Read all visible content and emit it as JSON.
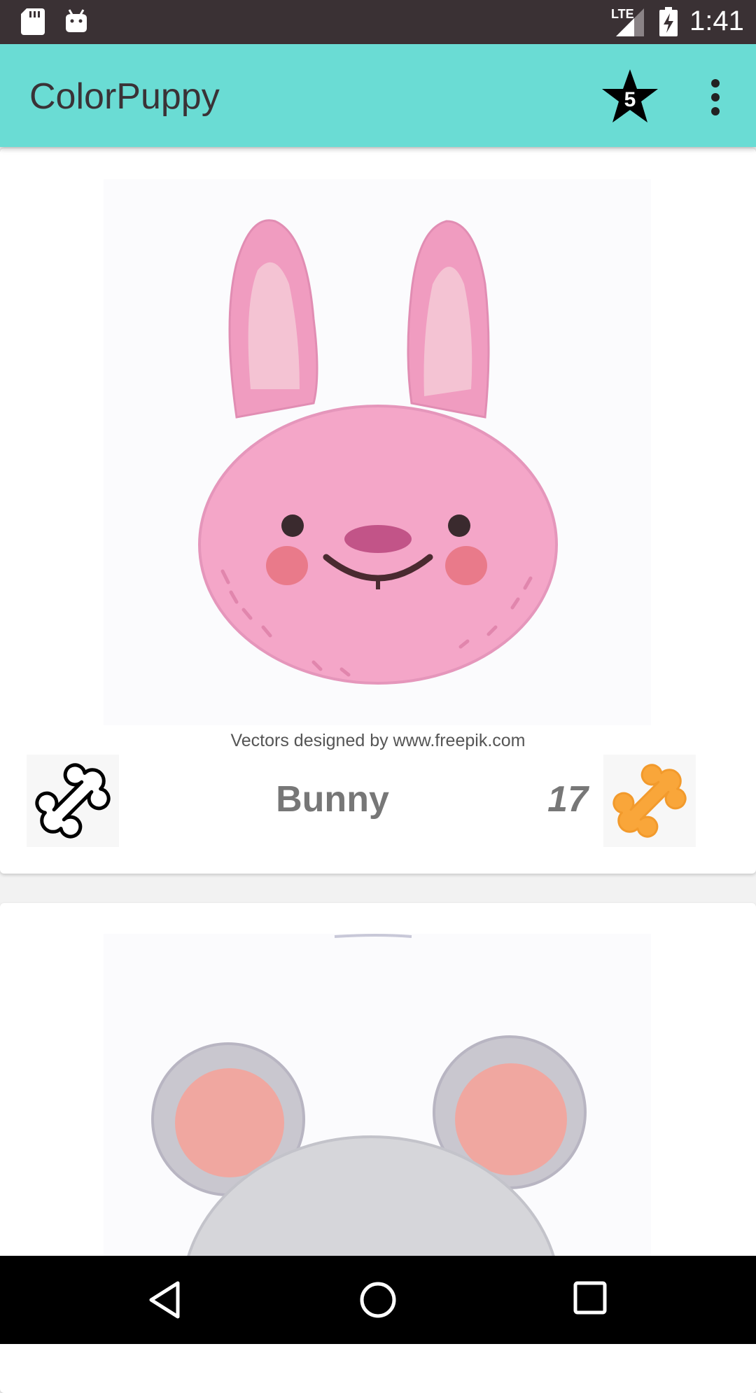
{
  "status_bar": {
    "network": "LTE",
    "time": "1:41"
  },
  "app_bar": {
    "title": "ColorPuppy",
    "star_count": "5"
  },
  "cards": [
    {
      "credit": "Vectors designed by www.freepik.com",
      "name": "Bunny",
      "count": "17"
    }
  ],
  "icons": {
    "sd": "sd-card-icon",
    "android": "android-icon",
    "signal": "signal-icon",
    "battery": "battery-charging-icon",
    "star": "star-icon",
    "more": "more-vert-icon",
    "bone_outline": "bone-outline-icon",
    "bone_filled": "bone-filled-icon",
    "back": "back-icon",
    "home": "home-icon",
    "recents": "recents-icon"
  },
  "colors": {
    "app_bar": "#6adcd4",
    "status_bar": "#3a3134",
    "bone_filled": "#f9a63a",
    "bunny": "#f4a6c8"
  }
}
